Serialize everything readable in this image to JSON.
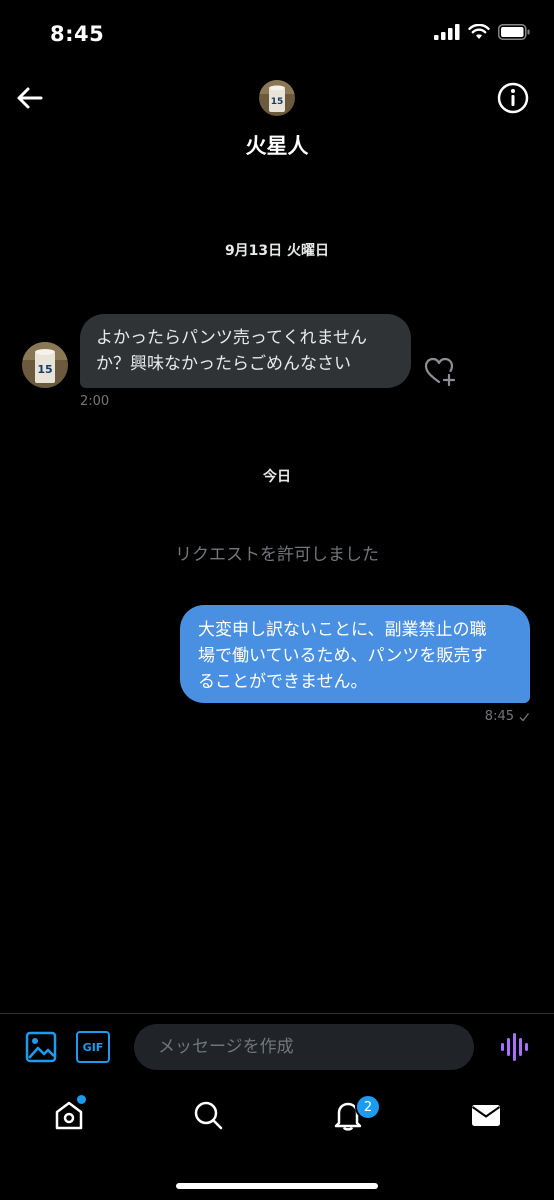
{
  "status_bar": {
    "time": "8:45"
  },
  "header": {
    "name": "火星人"
  },
  "conversation": {
    "date_separator_1": "9月13日 火曜日",
    "incoming_message": {
      "line1": "よかったらパンツ売ってくれません",
      "line2": "か？興味なかったらごめんなさい",
      "time": "2:00"
    },
    "date_separator_2": "今日",
    "system_message": "リクエストを許可しました",
    "outgoing_message": {
      "line1": "大変申し訳ないことに、副業禁止の職",
      "line2": "場で働いているため、パンツを販売す",
      "line3": "ることができません。",
      "time": "8:45"
    }
  },
  "composer": {
    "placeholder": "メッセージを作成",
    "gif_label": "GIF"
  },
  "tab_bar": {
    "notifications_badge": "2"
  },
  "colors": {
    "accent": "#1d9bf0",
    "outgoing_bubble": "#4a90e2",
    "incoming_bubble": "#2f3336",
    "voice": "#a970ff"
  }
}
